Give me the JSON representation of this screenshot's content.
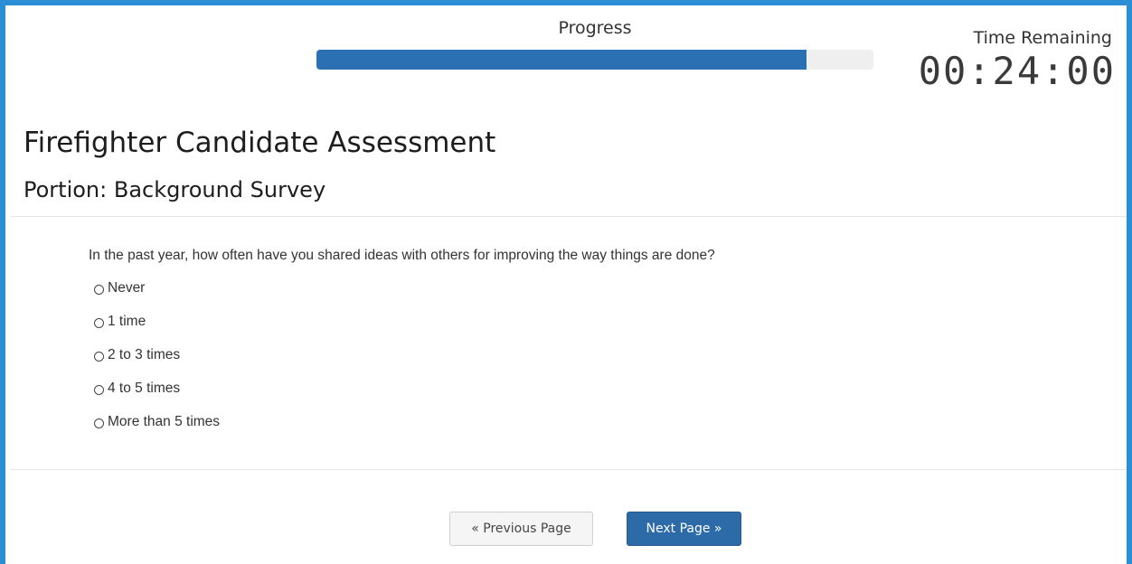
{
  "header": {
    "progress_label": "Progress",
    "progress_value": 0.88,
    "time_label": "Time Remaining",
    "time_value": "00:24:00"
  },
  "page": {
    "title": "Firefighter Candidate Assessment",
    "portion": "Portion: Background Survey"
  },
  "question": {
    "text": "In the past year, how often have you shared ideas with others for improving the way things are done?",
    "options": [
      {
        "label": "Never",
        "selected": false
      },
      {
        "label": "1 time",
        "selected": false
      },
      {
        "label": "2 to 3 times",
        "selected": false
      },
      {
        "label": "4 to 5 times",
        "selected": false
      },
      {
        "label": "More than 5 times",
        "selected": false
      }
    ]
  },
  "navigation": {
    "previous_label": "« Previous Page",
    "next_label": "Next Page »"
  },
  "colors": {
    "frame_border": "#2b8fd6",
    "progress_fill": "#2c70b4",
    "progress_track": "#efefef",
    "next_button": "#2c6aa8",
    "previous_button": "#f5f5f5"
  }
}
